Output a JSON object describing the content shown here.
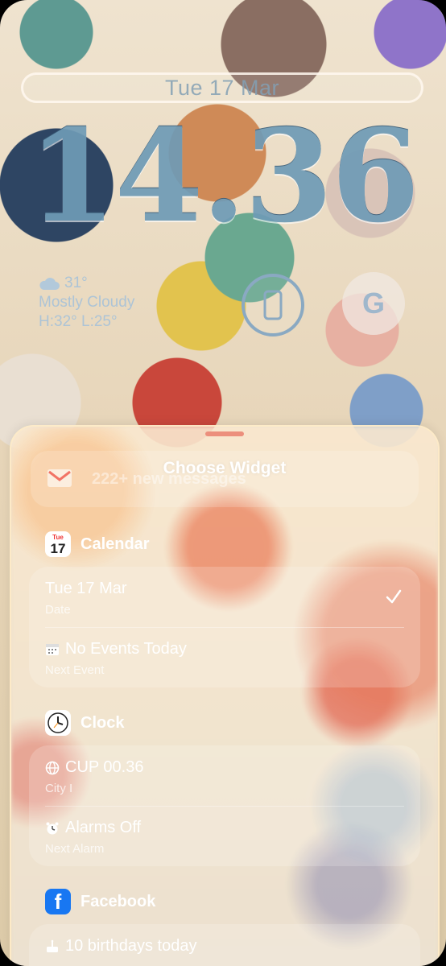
{
  "lockscreen": {
    "date": "Tue 17 Mar",
    "time": "14.36",
    "weather": {
      "temp": "31°",
      "condition": "Mostly Cloudy",
      "range": "H:32° L:25°"
    },
    "google_label": "G"
  },
  "sheet": {
    "title": "Choose Widget",
    "gmail": {
      "text": "222+ new messages"
    },
    "calendar": {
      "app_label": "Calendar",
      "icon_day": "Tue",
      "icon_date": "17",
      "items": [
        {
          "title": "Tue 17 Mar",
          "subtitle": "Date",
          "selected": true
        },
        {
          "title": "No Events Today",
          "subtitle": "Next Event"
        }
      ]
    },
    "clock": {
      "app_label": "Clock",
      "items": [
        {
          "title": "CUP 00.36",
          "subtitle": "City I"
        },
        {
          "title": "Alarms Off",
          "subtitle": "Next Alarm"
        }
      ]
    },
    "facebook": {
      "app_label": "Facebook",
      "items": [
        {
          "title": "10 birthdays today"
        }
      ]
    }
  },
  "icons": [
    "cloud-icon",
    "phone-icon",
    "gmail-icon",
    "calendar-icon",
    "checkmark-icon",
    "calendar-mini-icon",
    "clock-icon",
    "globe-icon",
    "alarm-icon",
    "facebook-icon",
    "cake-icon"
  ]
}
